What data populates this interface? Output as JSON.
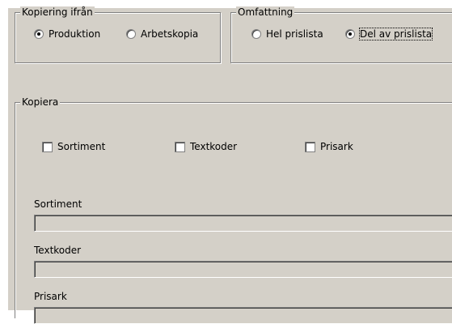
{
  "source_group": {
    "legend": "Kopiering ifrån",
    "options": [
      {
        "label": "Produktion",
        "checked": true
      },
      {
        "label": "Arbetskopia",
        "checked": false
      }
    ]
  },
  "scope_group": {
    "legend": "Omfattning",
    "options": [
      {
        "label": "Hel prislista",
        "checked": false
      },
      {
        "label": "Del av prislista",
        "checked": true
      }
    ]
  },
  "copy_group": {
    "legend": "Kopiera",
    "checkboxes": [
      {
        "label": "Sortiment",
        "checked": false
      },
      {
        "label": "Textkoder",
        "checked": false
      },
      {
        "label": "Prisark",
        "checked": false
      }
    ],
    "fields": [
      {
        "label": "Sortiment",
        "value": ""
      },
      {
        "label": "Textkoder",
        "value": ""
      },
      {
        "label": "Prisark",
        "value": ""
      }
    ]
  }
}
